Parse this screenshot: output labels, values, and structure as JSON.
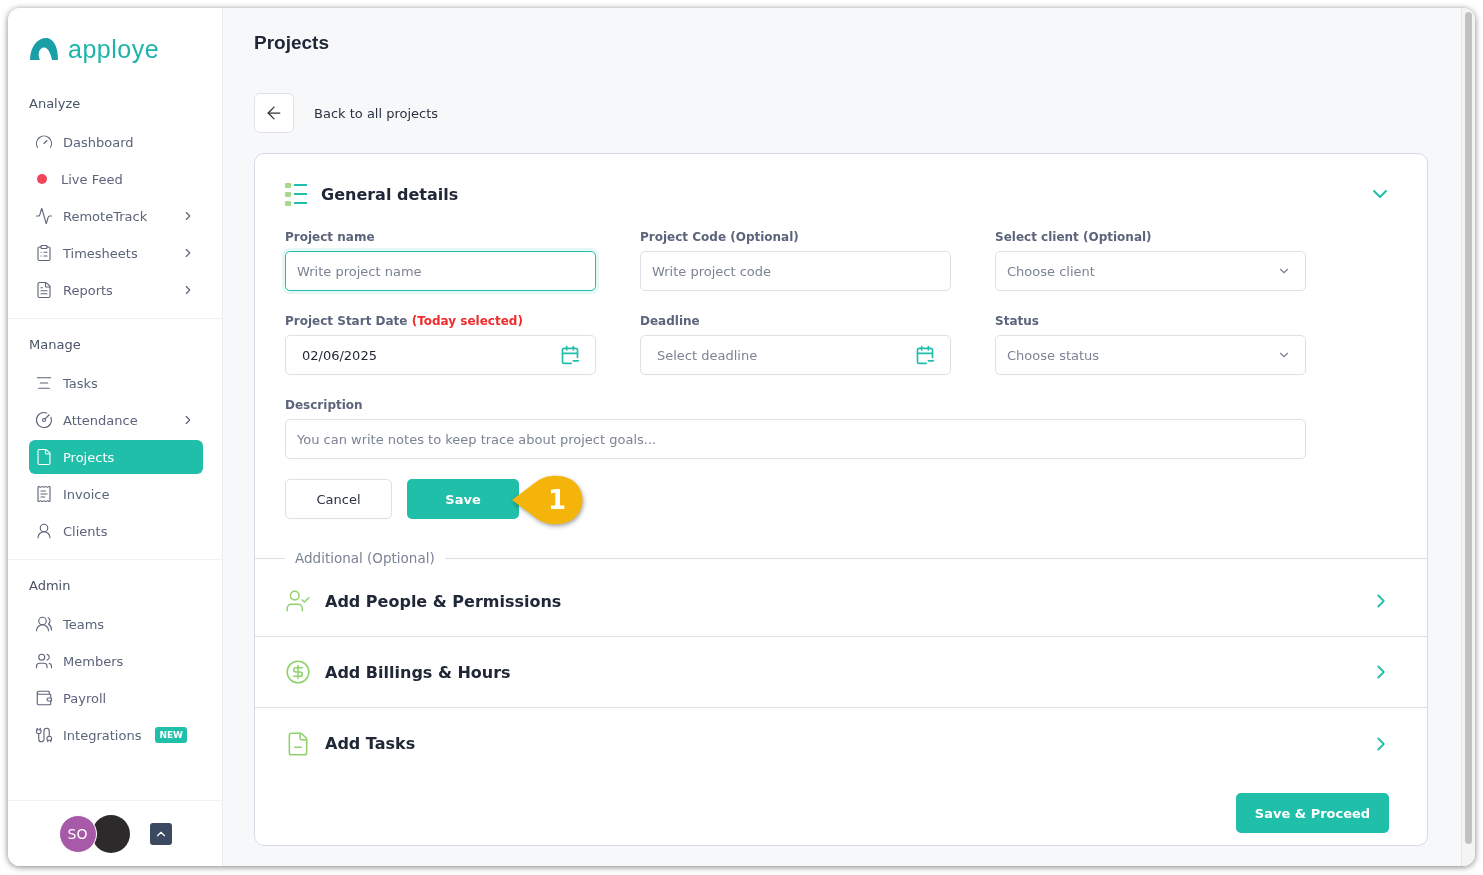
{
  "logo": {
    "text": "apploye"
  },
  "sidebar": {
    "sections": [
      {
        "title": "Analyze",
        "items": [
          {
            "label": "Dashboard",
            "kind": "icon",
            "has_submenu": false,
            "selected": false
          },
          {
            "label": "Live Feed",
            "kind": "live",
            "color": "#f2445a",
            "has_submenu": false,
            "selected": false
          },
          {
            "label": "RemoteTrack",
            "kind": "icon",
            "has_submenu": true,
            "selected": false
          },
          {
            "label": "Timesheets",
            "kind": "icon",
            "has_submenu": true,
            "selected": false
          },
          {
            "label": "Reports",
            "kind": "icon",
            "has_submenu": true,
            "selected": false
          }
        ]
      },
      {
        "title": "Manage",
        "items": [
          {
            "label": "Tasks",
            "kind": "icon",
            "has_submenu": false,
            "selected": false
          },
          {
            "label": "Attendance",
            "kind": "icon",
            "has_submenu": true,
            "selected": false
          },
          {
            "label": "Projects",
            "kind": "icon",
            "has_submenu": false,
            "selected": true
          },
          {
            "label": "Invoice",
            "kind": "icon",
            "has_submenu": false,
            "selected": false
          },
          {
            "label": "Clients",
            "kind": "icon",
            "has_submenu": false,
            "selected": false
          }
        ]
      },
      {
        "title": "Admin",
        "items": [
          {
            "label": "Teams",
            "kind": "icon",
            "has_submenu": false,
            "selected": false
          },
          {
            "label": "Members",
            "kind": "icon",
            "has_submenu": false,
            "selected": false
          },
          {
            "label": "Payroll",
            "kind": "icon",
            "has_submenu": false,
            "selected": false
          },
          {
            "label": "Integrations",
            "kind": "icon",
            "has_submenu": false,
            "selected": false,
            "badge": "NEW"
          }
        ]
      }
    ],
    "footer": {
      "avatar_initials": "SO"
    }
  },
  "page": {
    "title": "Projects",
    "back_link": "Back to all projects"
  },
  "general_details": {
    "title": "General details",
    "expanded": true,
    "fields": [
      {
        "kind": "text",
        "label": "Project name",
        "placeholder": "Write project name",
        "focused": true
      },
      {
        "kind": "text",
        "label": "Project Code (Optional)",
        "placeholder": "Write project code",
        "focused": false
      },
      {
        "kind": "select",
        "label": "Select client (Optional)",
        "placeholder": "Choose client",
        "focused": false
      },
      {
        "kind": "date",
        "label": "Project Start Date",
        "label_note": "(Today selected)",
        "value": "02/06/2025",
        "focused": false
      },
      {
        "kind": "date",
        "label": "Deadline",
        "placeholder": "Select deadline",
        "focused": false
      },
      {
        "kind": "select",
        "label": "Status",
        "placeholder": "Choose status",
        "focused": false
      },
      {
        "kind": "textarea",
        "label": "Description",
        "placeholder": "You can write notes to keep trace about project goals...",
        "focused": false
      }
    ],
    "buttons": [
      {
        "kind": "secondary",
        "label": "Cancel"
      },
      {
        "kind": "primary",
        "label": "Save"
      }
    ],
    "callout": "1"
  },
  "additional": {
    "title": "Additional (Optional)",
    "sections": [
      {
        "title": "Add People & Permissions",
        "expanded": false
      },
      {
        "title": "Add Billings & Hours",
        "expanded": false
      },
      {
        "title": "Add Tasks",
        "expanded": false
      }
    ]
  },
  "proceed_button": "Save & Proceed"
}
